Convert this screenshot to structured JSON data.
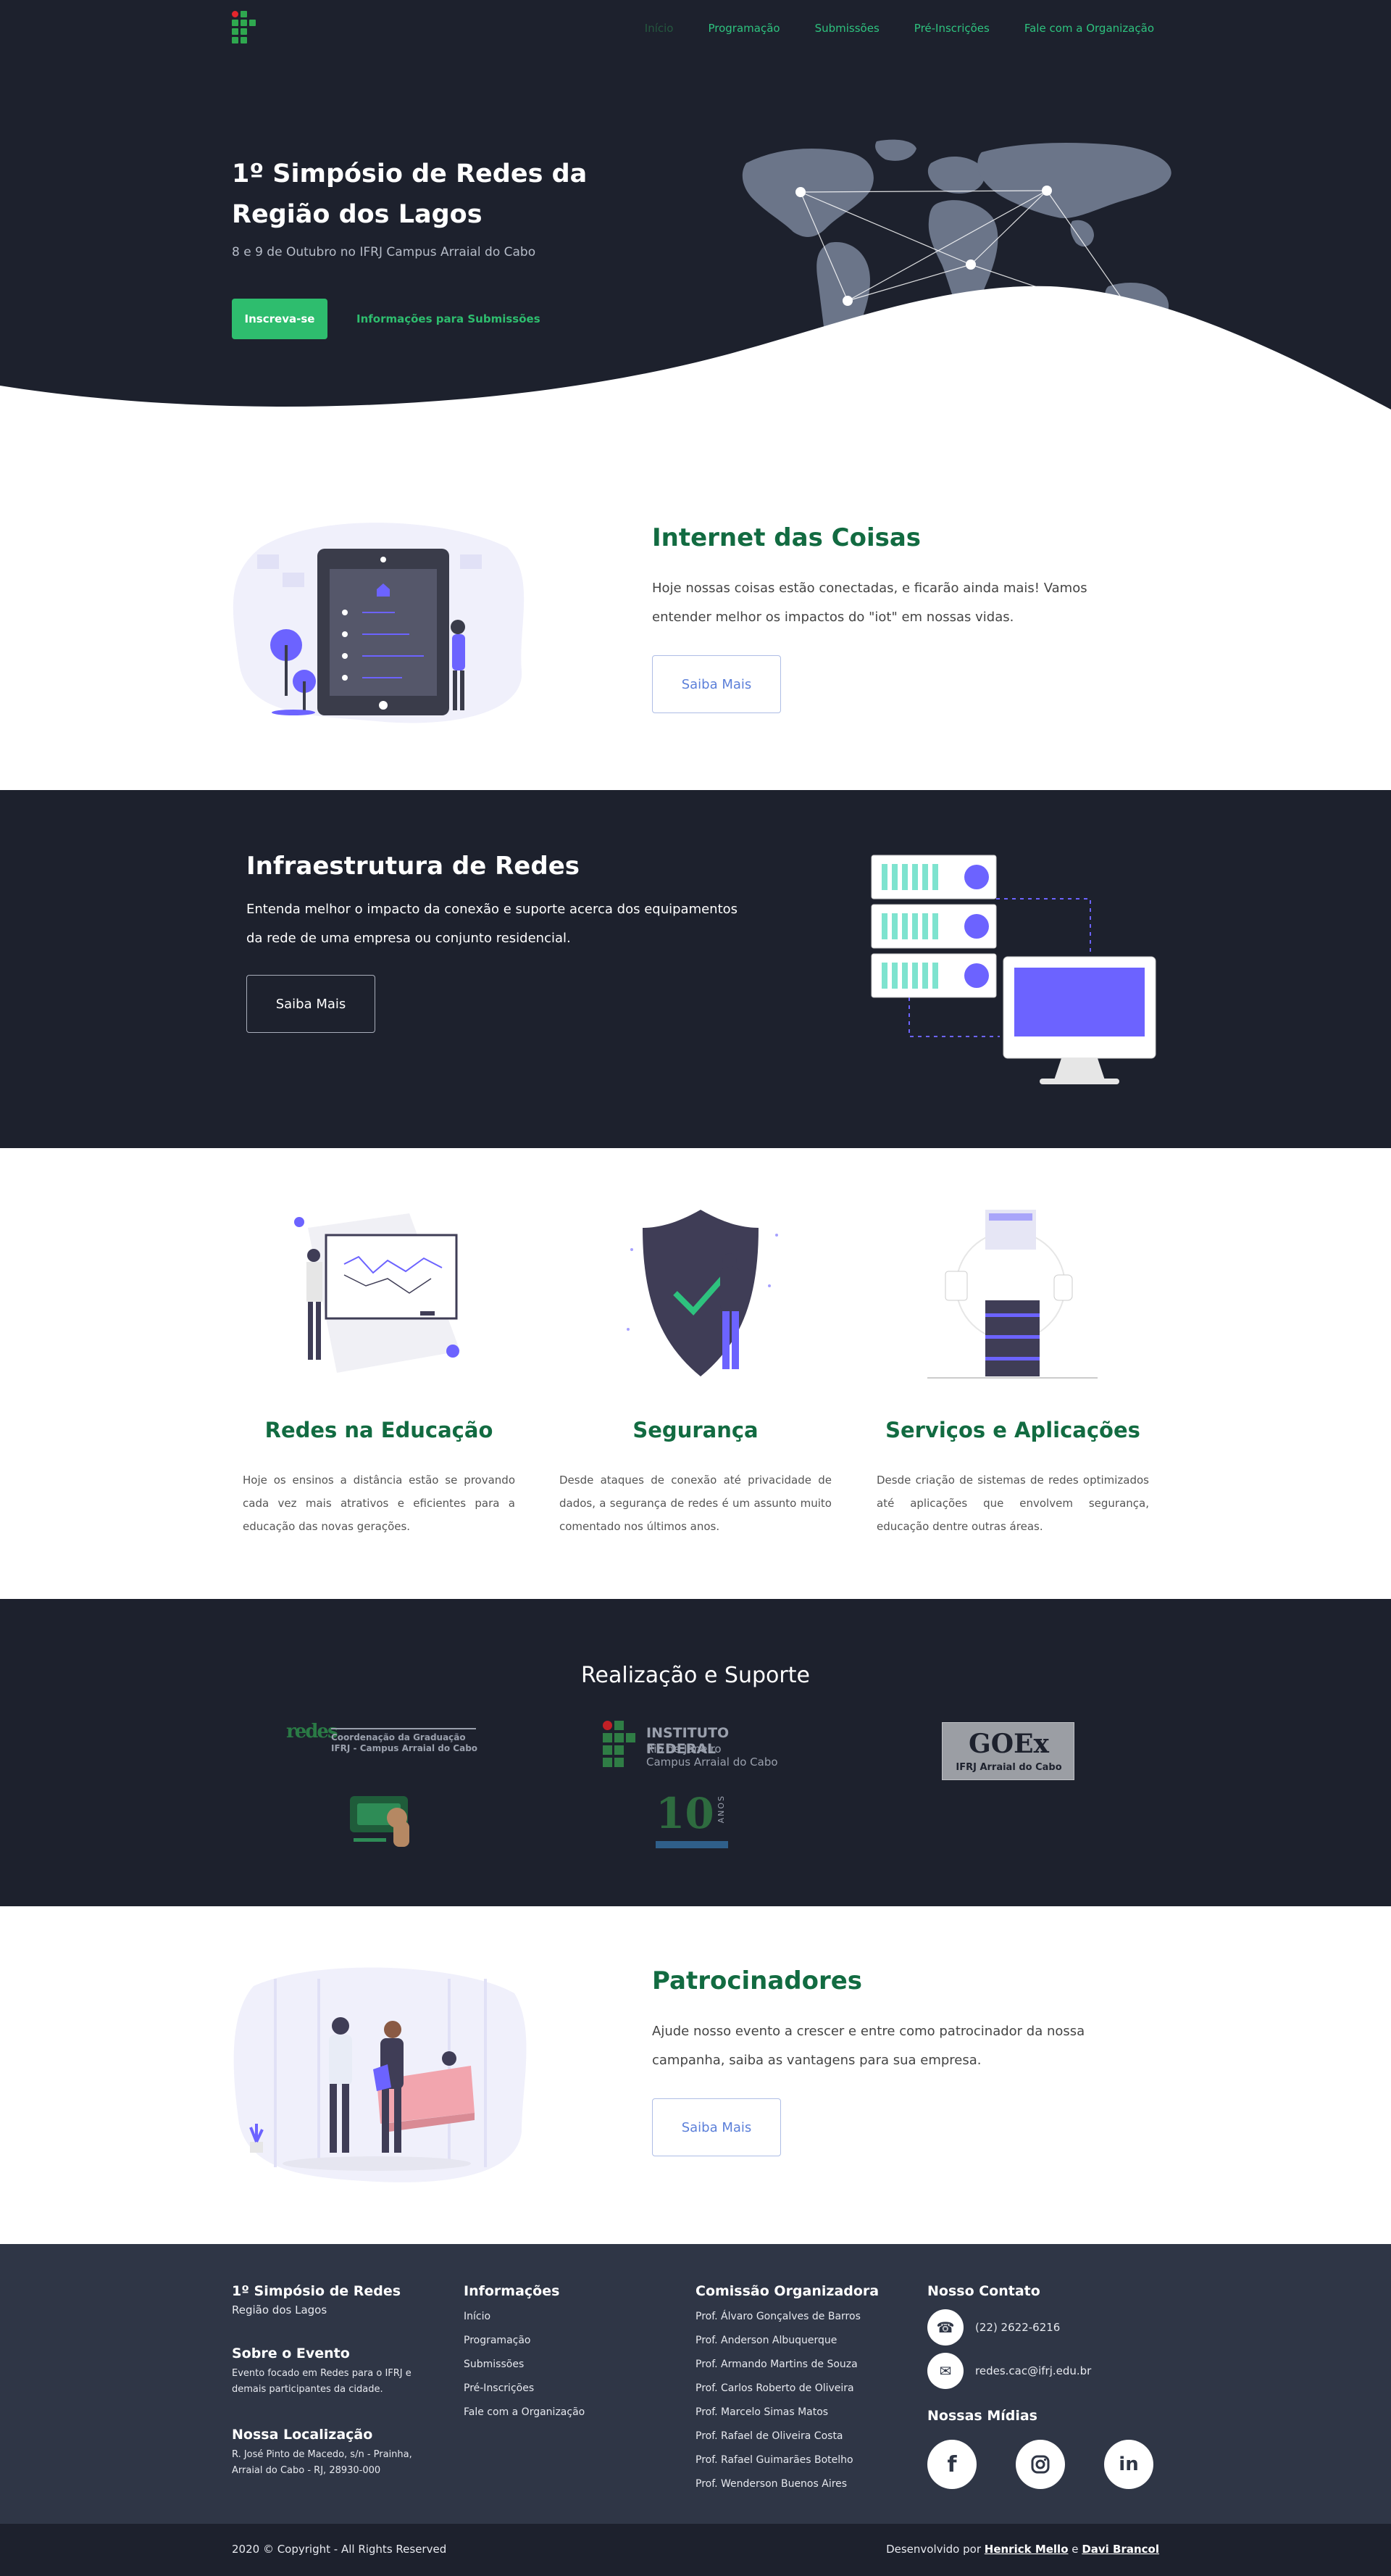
{
  "nav": {
    "links": [
      "Início",
      "Programação",
      "Submissões",
      "Pré-Inscrições",
      "Fale com a Organização"
    ]
  },
  "hero": {
    "title": "1º Simpósio de Redes da Região dos Lagos",
    "subtitle": "8 e 9 de Outubro no IFRJ Campus Arraial do Cabo",
    "primary_button": "Inscreva-se",
    "secondary_link": "Informações para Submissões"
  },
  "iot": {
    "title": "Internet das Coisas",
    "text": "Hoje nossas coisas estão conectadas, e ficarão ainda mais! Vamos entender melhor os impactos do \"iot\" em nossas vidas.",
    "button": "Saiba Mais"
  },
  "infra": {
    "title": "Infraestrutura de Redes",
    "text": "Entenda melhor o impacto da conexão e suporte acerca dos equipamentos da rede de uma empresa ou conjunto residencial.",
    "button": "Saiba Mais"
  },
  "cards": [
    {
      "title": "Redes na Educação",
      "text": "Hoje os ensinos a distância estão se provando cada vez mais atrativos e eficientes para a educação das novas gerações."
    },
    {
      "title": "Segurança",
      "text": "Desde ataques de conexão até privacidade de dados, a segurança de redes é um assunto muito comentado nos últimos anos."
    },
    {
      "title": "Serviços e Aplicações",
      "text": "Desde criação de sistemas de redes optimizados até aplicações que envolvem segurança, educação dentre outras áreas."
    }
  ],
  "support": {
    "title": "Realização e Suporte",
    "logos": {
      "coord_title": "Coordenação da Graduação",
      "coord_sub": "IFRJ - Campus Arraial do Cabo",
      "if_line1": "INSTITUTO FEDERAL",
      "if_line2": "Rio de Janeiro",
      "if_line3": "Campus Arraial do Cabo",
      "goex_name": "GOEx",
      "goex_sub": "IFRJ Arraial do Cabo",
      "anos": "ANOS"
    }
  },
  "sponsors": {
    "title": "Patrocinadores",
    "text": "Ajude nosso evento a crescer e entre como patrocinador da nossa campanha, saiba as vantagens para sua empresa.",
    "button": "Saiba Mais"
  },
  "footer": {
    "event_title": "1º Simpósio de Redes",
    "event_sub": "Região dos Lagos",
    "about_title": "Sobre o Evento",
    "about_text": "Evento focado em Redes para o IFRJ e demais participantes da cidade.",
    "location_title": "Nossa Localização",
    "location_text": "R. José Pinto de Macedo, s/n - Prainha, Arraial do Cabo - RJ, 28930-000",
    "info_title": "Informações",
    "info_links": [
      "Início",
      "Programação",
      "Submissões",
      "Pré-Inscrições",
      "Fale com a Organização"
    ],
    "committee_title": "Comissão Organizadora",
    "committee": [
      "Prof. Álvaro Gonçalves de Barros",
      "Prof. Anderson Albuquerque",
      "Prof. Armando Martins de Souza",
      "Prof. Carlos Roberto de Oliveira",
      "Prof. Marcelo Simas Matos",
      "Prof. Rafael de Oliveira Costa",
      "Prof. Rafael Guimarães Botelho",
      "Prof. Wenderson Buenos Aires"
    ],
    "contact_title": "Nosso Contato",
    "phone": "(22) 2622-6216",
    "email": "redes.cac@ifrj.edu.br",
    "social_title": "Nossas Mídias",
    "social_icons": [
      "facebook-icon",
      "instagram-icon",
      "linkedin-icon"
    ],
    "copyright": "2020 © Copyright - All Rights Reserved",
    "dev_prefix": "Desenvolvido por",
    "dev_1": "Henrick Mello",
    "dev_and": "e",
    "dev_2": "Davi Brancol"
  },
  "colors": {
    "dark": "#1d212d",
    "footer": "#2f3646",
    "green": "#2ebd6e",
    "dark_green": "#126b41",
    "purple": "#6c63ff",
    "map": "#6b7589"
  }
}
